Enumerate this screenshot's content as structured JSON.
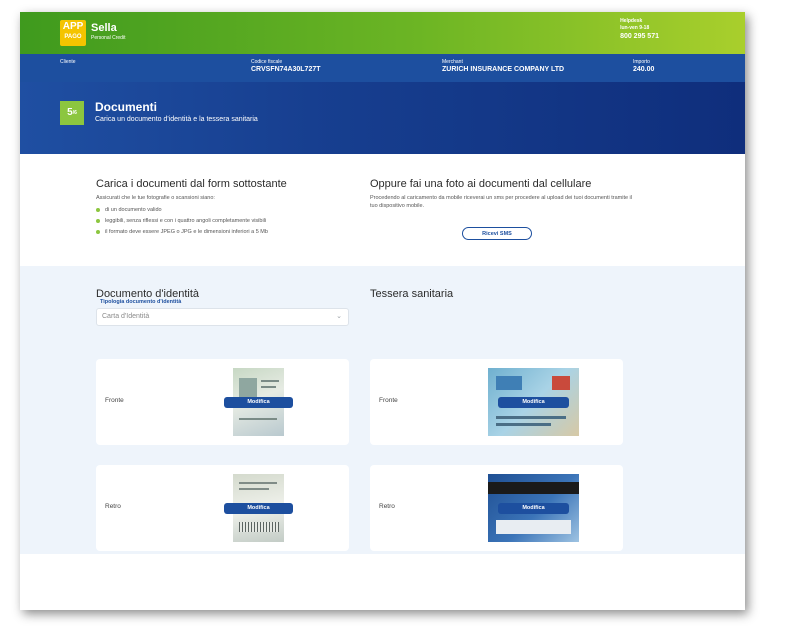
{
  "header": {
    "logo_top": "APP",
    "logo_bottom": "PAGO",
    "brand_name": "Sella",
    "brand_sub": "Personal Credit",
    "helpdesk_title": "Helpdesk",
    "helpdesk_hours": "lun-ven 9-18",
    "helpdesk_phone": "800 295 571",
    "bg_colors": [
      "#3f9a1e",
      "#a9cf2c"
    ]
  },
  "info": {
    "cliente_label": "Cliente",
    "cf_label": "Codice fiscale",
    "cf_value": "CRVSFN74A30L727T",
    "merchant_label": "Merchant",
    "merchant_value": "ZURICH INSURANCE COMPANY LTD",
    "importo_label": "Importo",
    "importo_value": "240.00"
  },
  "title": {
    "step_number": "5",
    "step_total": "/6",
    "heading": "Documenti",
    "subheading": "Carica un documento d'identità e la tessera sanitaria"
  },
  "instructions": {
    "left_title": "Carica i documenti dal form sottostante",
    "left_sub": "Assicurati che le tue fotografie o scansioni siano:",
    "bullets": [
      "di un documento valido",
      "leggibili, senza riflessi e con i quattro angoli completamente visibili",
      "il formato deve essere JPEG o JPG e le dimensioni inferiori a 5 Mb"
    ],
    "right_title": "Oppure fai una foto ai documenti dal cellulare",
    "right_sub": "Procedendo al caricamento da mobile riceverai un sms per procedere al upload dei tuoi documenti tramite il tuo dispositivo mobile.",
    "sms_button": "Ricevi SMS"
  },
  "upload": {
    "id_title": "Documento d'identità",
    "ts_title": "Tessera sanitaria",
    "select_label": "Tipologia documento d'identità",
    "select_value": "Carta d'Identità",
    "front_label": "Fronte",
    "back_label": "Retro",
    "edit_label": "Modifica",
    "accent": "#1d4f9f"
  }
}
